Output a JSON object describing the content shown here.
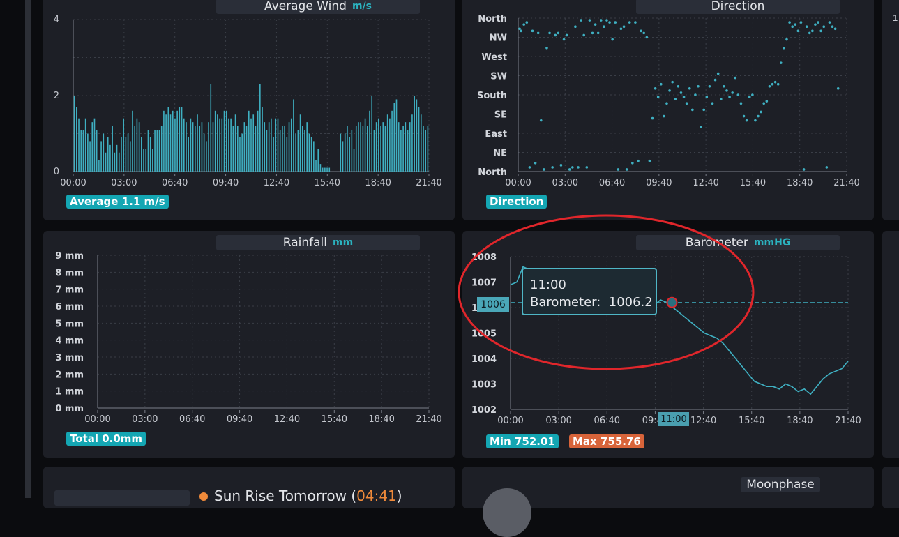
{
  "panels": {
    "wind": {
      "title": "Average Wind",
      "unit": "m/s",
      "yticks": [
        "4",
        "2",
        "0"
      ],
      "xticks": [
        "00:00",
        "03:00",
        "06:40",
        "09:40",
        "12:40",
        "15:40",
        "18:40",
        "21:40"
      ],
      "badge": "Average 1.1 m/s"
    },
    "direction": {
      "title": "Direction",
      "yticks": [
        "North",
        "NW",
        "West",
        "SW",
        "South",
        "SE",
        "East",
        "NE",
        "North"
      ],
      "xticks": [
        "00:00",
        "03:00",
        "06:40",
        "09:40",
        "12:40",
        "15:40",
        "18:40",
        "21:40"
      ],
      "badge": "Direction"
    },
    "rainfall": {
      "title": "Rainfall",
      "unit": "mm",
      "yticks": [
        "9 mm",
        "8 mm",
        "7 mm",
        "6 mm",
        "5 mm",
        "4 mm",
        "3 mm",
        "2 mm",
        "1 mm",
        "0 mm"
      ],
      "xticks": [
        "00:00",
        "03:00",
        "06:40",
        "09:40",
        "12:40",
        "15:40",
        "18:40",
        "21:40"
      ],
      "badge": "Total 0.0mm"
    },
    "barometer": {
      "title": "Barometer",
      "unit": "mmHG",
      "yticks": [
        "1008",
        "1007",
        "1006",
        "1005",
        "1004",
        "1003",
        "1002"
      ],
      "xticks": [
        "00:00",
        "03:00",
        "06:40",
        "09:40",
        "12:40",
        "15:40",
        "18:40",
        "21:40"
      ],
      "min_badge": "Min 752.01",
      "max_badge": "Max 755.76",
      "tooltip": {
        "time": "11:00",
        "label": "Barometer:",
        "value": "1006.2"
      },
      "crosshair_x_label": "11:00",
      "crosshair_y_label": "1006"
    },
    "sun": {
      "label": "Sun Rise Tomorrow (",
      "time": "04:41",
      "close": ")"
    },
    "moon": {
      "title": "Moonphase"
    }
  },
  "right_edge": {
    "top_tick": "1"
  },
  "colors": {
    "accent": "#14a6b3",
    "line": "#3fb0c2",
    "warn": "#d8643a",
    "annotation": "#e0262b"
  },
  "chart_data": [
    {
      "type": "bar",
      "title": "Average Wind",
      "ylabel": "m/s",
      "ylim": [
        0,
        4
      ],
      "x_range": [
        "00:00",
        "23:00"
      ],
      "values": [
        2.0,
        1.7,
        1.4,
        1.1,
        1.1,
        1.4,
        1.0,
        0.8,
        1.3,
        1.4,
        1.1,
        0.3,
        0.8,
        1.0,
        0.5,
        0.9,
        0.7,
        1.2,
        0.5,
        0.7,
        0.5,
        0.9,
        1.4,
        0.9,
        1.0,
        0.8,
        1.6,
        1.2,
        1.4,
        1.3,
        0.9,
        0.6,
        0.6,
        1.1,
        0.9,
        0.6,
        1.1,
        1.1,
        1.1,
        1.2,
        1.6,
        1.5,
        1.7,
        1.5,
        1.6,
        1.4,
        1.6,
        1.7,
        1.7,
        1.4,
        1.3,
        0.9,
        1.4,
        1.3,
        1.2,
        1.5,
        1.2,
        1.3,
        1.0,
        0.8,
        1.3,
        2.3,
        1.3,
        1.6,
        1.5,
        1.4,
        1.4,
        1.6,
        1.6,
        1.4,
        1.4,
        1.2,
        1.5,
        1.2,
        0.9,
        1.0,
        1.3,
        1.2,
        1.6,
        1.4,
        1.5,
        1.2,
        1.6,
        2.3,
        1.7,
        1.3,
        1.1,
        1.3,
        1.4,
        0.9,
        1.4,
        1.4,
        1.1,
        1.2,
        1.2,
        0.9,
        1.3,
        1.4,
        1.9,
        1.0,
        1.1,
        1.5,
        1.2,
        1.1,
        1.3,
        1.0,
        0.9,
        0.8,
        0.3,
        0.6,
        0.2,
        0.1,
        0.1,
        0.1,
        0.1,
        0.0,
        0.0,
        0.0,
        0.0,
        1.0,
        0.8,
        1.0,
        1.2,
        0.9,
        1.1,
        0.6,
        1.2,
        1.3,
        1.3,
        1.2,
        1.4,
        1.2,
        1.6,
        2.0,
        1.1,
        1.3,
        1.4,
        1.2,
        1.3,
        1.2,
        1.5,
        1.4,
        1.6,
        1.8,
        1.9,
        1.3,
        1.1,
        1.2,
        1.3,
        1.1,
        1.3,
        1.5,
        2.0,
        1.9,
        1.7,
        1.5,
        1.2,
        1.1,
        1.2
      ]
    },
    {
      "type": "scatter",
      "title": "Direction",
      "y_categories": [
        "North",
        "NE",
        "East",
        "SE",
        "South",
        "SW",
        "West",
        "NW",
        "North"
      ],
      "ylim": [
        0,
        360
      ],
      "x_range": [
        "00:00",
        "23:00"
      ],
      "points": [
        [
          0.1,
          335
        ],
        [
          0.2,
          330
        ],
        [
          0.4,
          345
        ],
        [
          0.6,
          350
        ],
        [
          0.8,
          10
        ],
        [
          1.0,
          330
        ],
        [
          1.2,
          20
        ],
        [
          1.4,
          325
        ],
        [
          1.6,
          120
        ],
        [
          1.8,
          5
        ],
        [
          2.0,
          290
        ],
        [
          2.2,
          325
        ],
        [
          2.4,
          10
        ],
        [
          2.6,
          320
        ],
        [
          2.8,
          325
        ],
        [
          3.0,
          15
        ],
        [
          3.2,
          310
        ],
        [
          3.4,
          320
        ],
        [
          3.6,
          5
        ],
        [
          3.8,
          10
        ],
        [
          4.0,
          340
        ],
        [
          4.2,
          10
        ],
        [
          4.4,
          355
        ],
        [
          4.6,
          320
        ],
        [
          4.8,
          10
        ],
        [
          5.0,
          355
        ],
        [
          5.2,
          325
        ],
        [
          5.4,
          345
        ],
        [
          5.6,
          325
        ],
        [
          5.8,
          355
        ],
        [
          6.0,
          340
        ],
        [
          6.2,
          355
        ],
        [
          6.4,
          350
        ],
        [
          6.6,
          310
        ],
        [
          6.8,
          350
        ],
        [
          7.0,
          5
        ],
        [
          7.2,
          335
        ],
        [
          7.4,
          340
        ],
        [
          7.6,
          5
        ],
        [
          7.8,
          350
        ],
        [
          8.0,
          20
        ],
        [
          8.2,
          350
        ],
        [
          8.4,
          25
        ],
        [
          8.6,
          330
        ],
        [
          8.8,
          325
        ],
        [
          9.0,
          315
        ],
        [
          9.2,
          25
        ],
        [
          9.4,
          125
        ],
        [
          9.6,
          195
        ],
        [
          9.8,
          175
        ],
        [
          10.0,
          205
        ],
        [
          10.2,
          130
        ],
        [
          10.4,
          160
        ],
        [
          10.6,
          190
        ],
        [
          10.8,
          210
        ],
        [
          11.0,
          170
        ],
        [
          11.2,
          200
        ],
        [
          11.4,
          185
        ],
        [
          11.6,
          175
        ],
        [
          11.8,
          160
        ],
        [
          12.0,
          195
        ],
        [
          12.2,
          145
        ],
        [
          12.4,
          180
        ],
        [
          12.6,
          200
        ],
        [
          12.8,
          105
        ],
        [
          13.0,
          145
        ],
        [
          13.2,
          175
        ],
        [
          13.4,
          200
        ],
        [
          13.6,
          160
        ],
        [
          13.8,
          215
        ],
        [
          14.0,
          230
        ],
        [
          14.2,
          170
        ],
        [
          14.4,
          200
        ],
        [
          14.6,
          190
        ],
        [
          14.8,
          175
        ],
        [
          15.0,
          185
        ],
        [
          15.2,
          220
        ],
        [
          15.4,
          180
        ],
        [
          15.6,
          160
        ],
        [
          15.8,
          130
        ],
        [
          16.0,
          120
        ],
        [
          16.2,
          175
        ],
        [
          16.4,
          180
        ],
        [
          16.6,
          120
        ],
        [
          16.8,
          130
        ],
        [
          17.0,
          140
        ],
        [
          17.2,
          160
        ],
        [
          17.4,
          165
        ],
        [
          17.6,
          200
        ],
        [
          17.8,
          205
        ],
        [
          18.0,
          210
        ],
        [
          18.2,
          205
        ],
        [
          18.4,
          255
        ],
        [
          18.6,
          290
        ],
        [
          18.8,
          310
        ],
        [
          19.0,
          350
        ],
        [
          19.2,
          340
        ],
        [
          19.4,
          345
        ],
        [
          19.6,
          330
        ],
        [
          19.8,
          350
        ],
        [
          20.0,
          5
        ],
        [
          20.2,
          340
        ],
        [
          20.4,
          325
        ],
        [
          20.6,
          330
        ],
        [
          20.8,
          345
        ],
        [
          21.0,
          350
        ],
        [
          21.2,
          330
        ],
        [
          21.4,
          340
        ],
        [
          21.6,
          10
        ],
        [
          21.8,
          350
        ],
        [
          22.0,
          340
        ],
        [
          22.2,
          335
        ],
        [
          22.4,
          195
        ]
      ]
    },
    {
      "type": "line",
      "title": "Rainfall",
      "ylabel": "mm",
      "ylim": [
        0,
        9
      ],
      "x_range": [
        "00:00",
        "23:00"
      ],
      "values": []
    },
    {
      "type": "line",
      "title": "Barometer",
      "ylabel": "mmHG",
      "ylim": [
        1002,
        1008
      ],
      "x_range": [
        "00:00",
        "23:00"
      ],
      "x": [
        0,
        0.5,
        1.0,
        1.5,
        2.0,
        2.5,
        3.0,
        3.5,
        4.0,
        4.5,
        5.0,
        5.5,
        6.0,
        6.5,
        7.0,
        7.5,
        8.0,
        8.5,
        9.0,
        9.5,
        10.0,
        10.5,
        11.0,
        11.5,
        12.0,
        12.5,
        13.0,
        13.5,
        14.0,
        14.5,
        15.0,
        15.5,
        16.0,
        16.5,
        17.0,
        17.5,
        18.0,
        18.5,
        19.0,
        19.5,
        20.0,
        20.5,
        21.0,
        21.5,
        22.0,
        22.5,
        23.0
      ],
      "values": [
        1006.9,
        1007.0,
        1007.6,
        1007.5,
        1007.3,
        1007.2,
        1007.1,
        1007.0,
        1007.0,
        1006.9,
        1006.8,
        1006.7,
        1006.7,
        1006.6,
        1006.6,
        1006.5,
        1006.5,
        1006.4,
        1006.4,
        1006.3,
        1006.3,
        1006.2,
        1006.2,
        1006.1,
        1006.3,
        1006.2,
        1006.0,
        1005.8,
        1005.6,
        1005.4,
        1005.2,
        1005.0,
        1004.9,
        1004.8,
        1004.6,
        1004.3,
        1004.0,
        1003.7,
        1003.4,
        1003.1,
        1003.0,
        1002.9,
        1002.9,
        1002.8,
        1003.0,
        1002.9,
        1002.7,
        1002.8,
        1002.6,
        1002.9,
        1003.2,
        1003.4,
        1003.5,
        1003.6,
        1003.9
      ],
      "tooltip": {
        "x": "11:00",
        "value": 1006.2
      }
    }
  ]
}
